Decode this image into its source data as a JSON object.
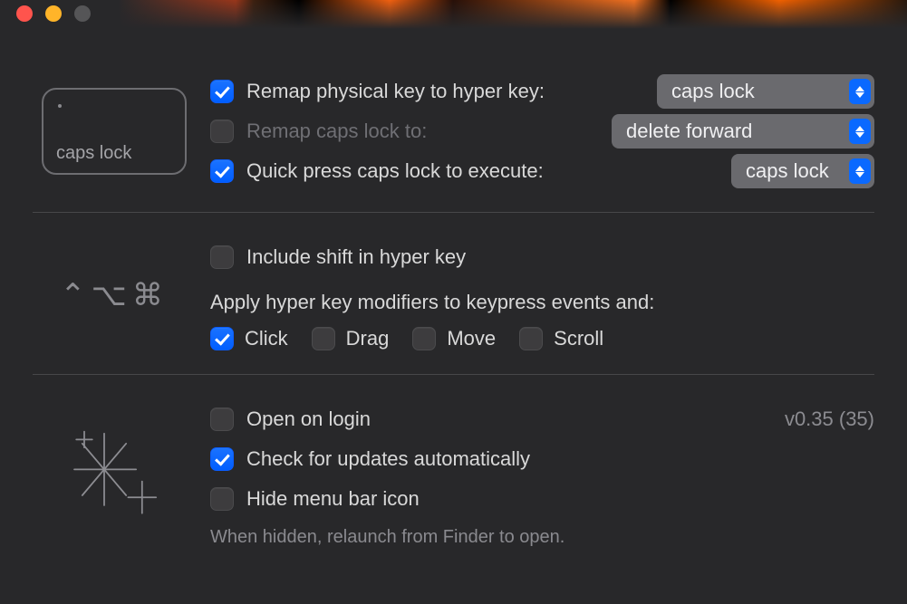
{
  "keycap_label": "caps lock",
  "panel1": {
    "remap_label": "Remap physical key to hyper key:",
    "remap_select": "caps lock",
    "capsremap_label": "Remap caps lock to:",
    "capsremap_select": "delete forward",
    "quickpress_label": "Quick press caps lock to execute:",
    "quickpress_select": "caps lock"
  },
  "panel2": {
    "shift_label": "Include shift in hyper key",
    "subheading": "Apply hyper key modifiers to keypress events and:",
    "click_label": "Click",
    "drag_label": "Drag",
    "move_label": "Move",
    "scroll_label": "Scroll",
    "mod_glyphs": "⌃⌥⌘"
  },
  "panel3": {
    "openlogin_label": "Open on login",
    "updates_label": "Check for updates automatically",
    "hideicon_label": "Hide menu bar icon",
    "hint": "When hidden, relaunch from Finder to open.",
    "version": "v0.35 (35)"
  },
  "state": {
    "remap_checked": true,
    "capsremap_checked": false,
    "quickpress_checked": true,
    "shift_checked": false,
    "click_checked": true,
    "drag_checked": false,
    "move_checked": false,
    "scroll_checked": false,
    "openlogin_checked": false,
    "updates_checked": true,
    "hideicon_checked": false
  }
}
